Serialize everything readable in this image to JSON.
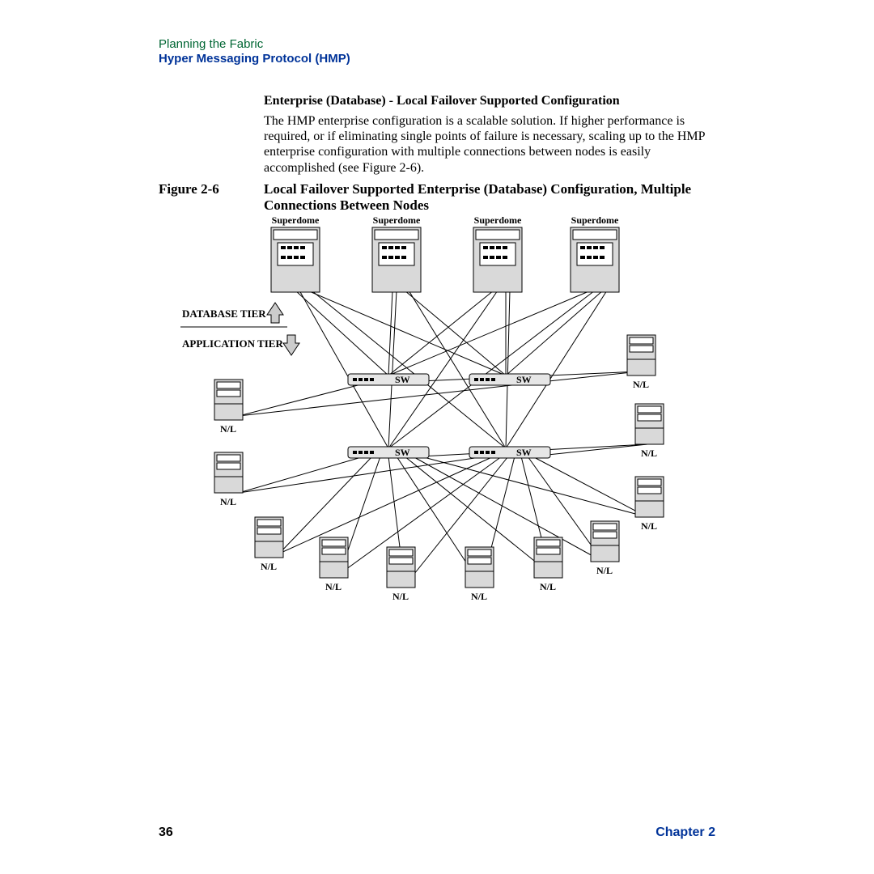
{
  "header": {
    "line1": "Planning the Fabric",
    "line2": "Hyper Messaging Protocol (HMP)"
  },
  "section_title": "Enterprise (Database) - Local Failover Supported Configuration",
  "body_text": "The HMP enterprise configuration is a scalable solution. If higher performance is required, or if eliminating single points of failure is necessary, scaling up to the HMP enterprise configuration with multiple connections between nodes is easily accomplished (see Figure 2-6).",
  "figure": {
    "label": "Figure 2-6",
    "title": "Local Failover Supported Enterprise (Database) Configuration, Multiple Connections Between Nodes",
    "tiers": {
      "database": "DATABASE TIER",
      "application": "APPLICATION TIER"
    },
    "superdomes": [
      "Superdome",
      "Superdome",
      "Superdome",
      "Superdome"
    ],
    "switches": [
      "SW",
      "SW",
      "SW",
      "SW"
    ],
    "nodes": [
      "N/L",
      "N/L",
      "N/L",
      "N/L",
      "N/L",
      "N/L",
      "N/L",
      "N/L",
      "N/L",
      "N/L"
    ]
  },
  "footer": {
    "page_number": "36",
    "chapter": "Chapter 2"
  }
}
